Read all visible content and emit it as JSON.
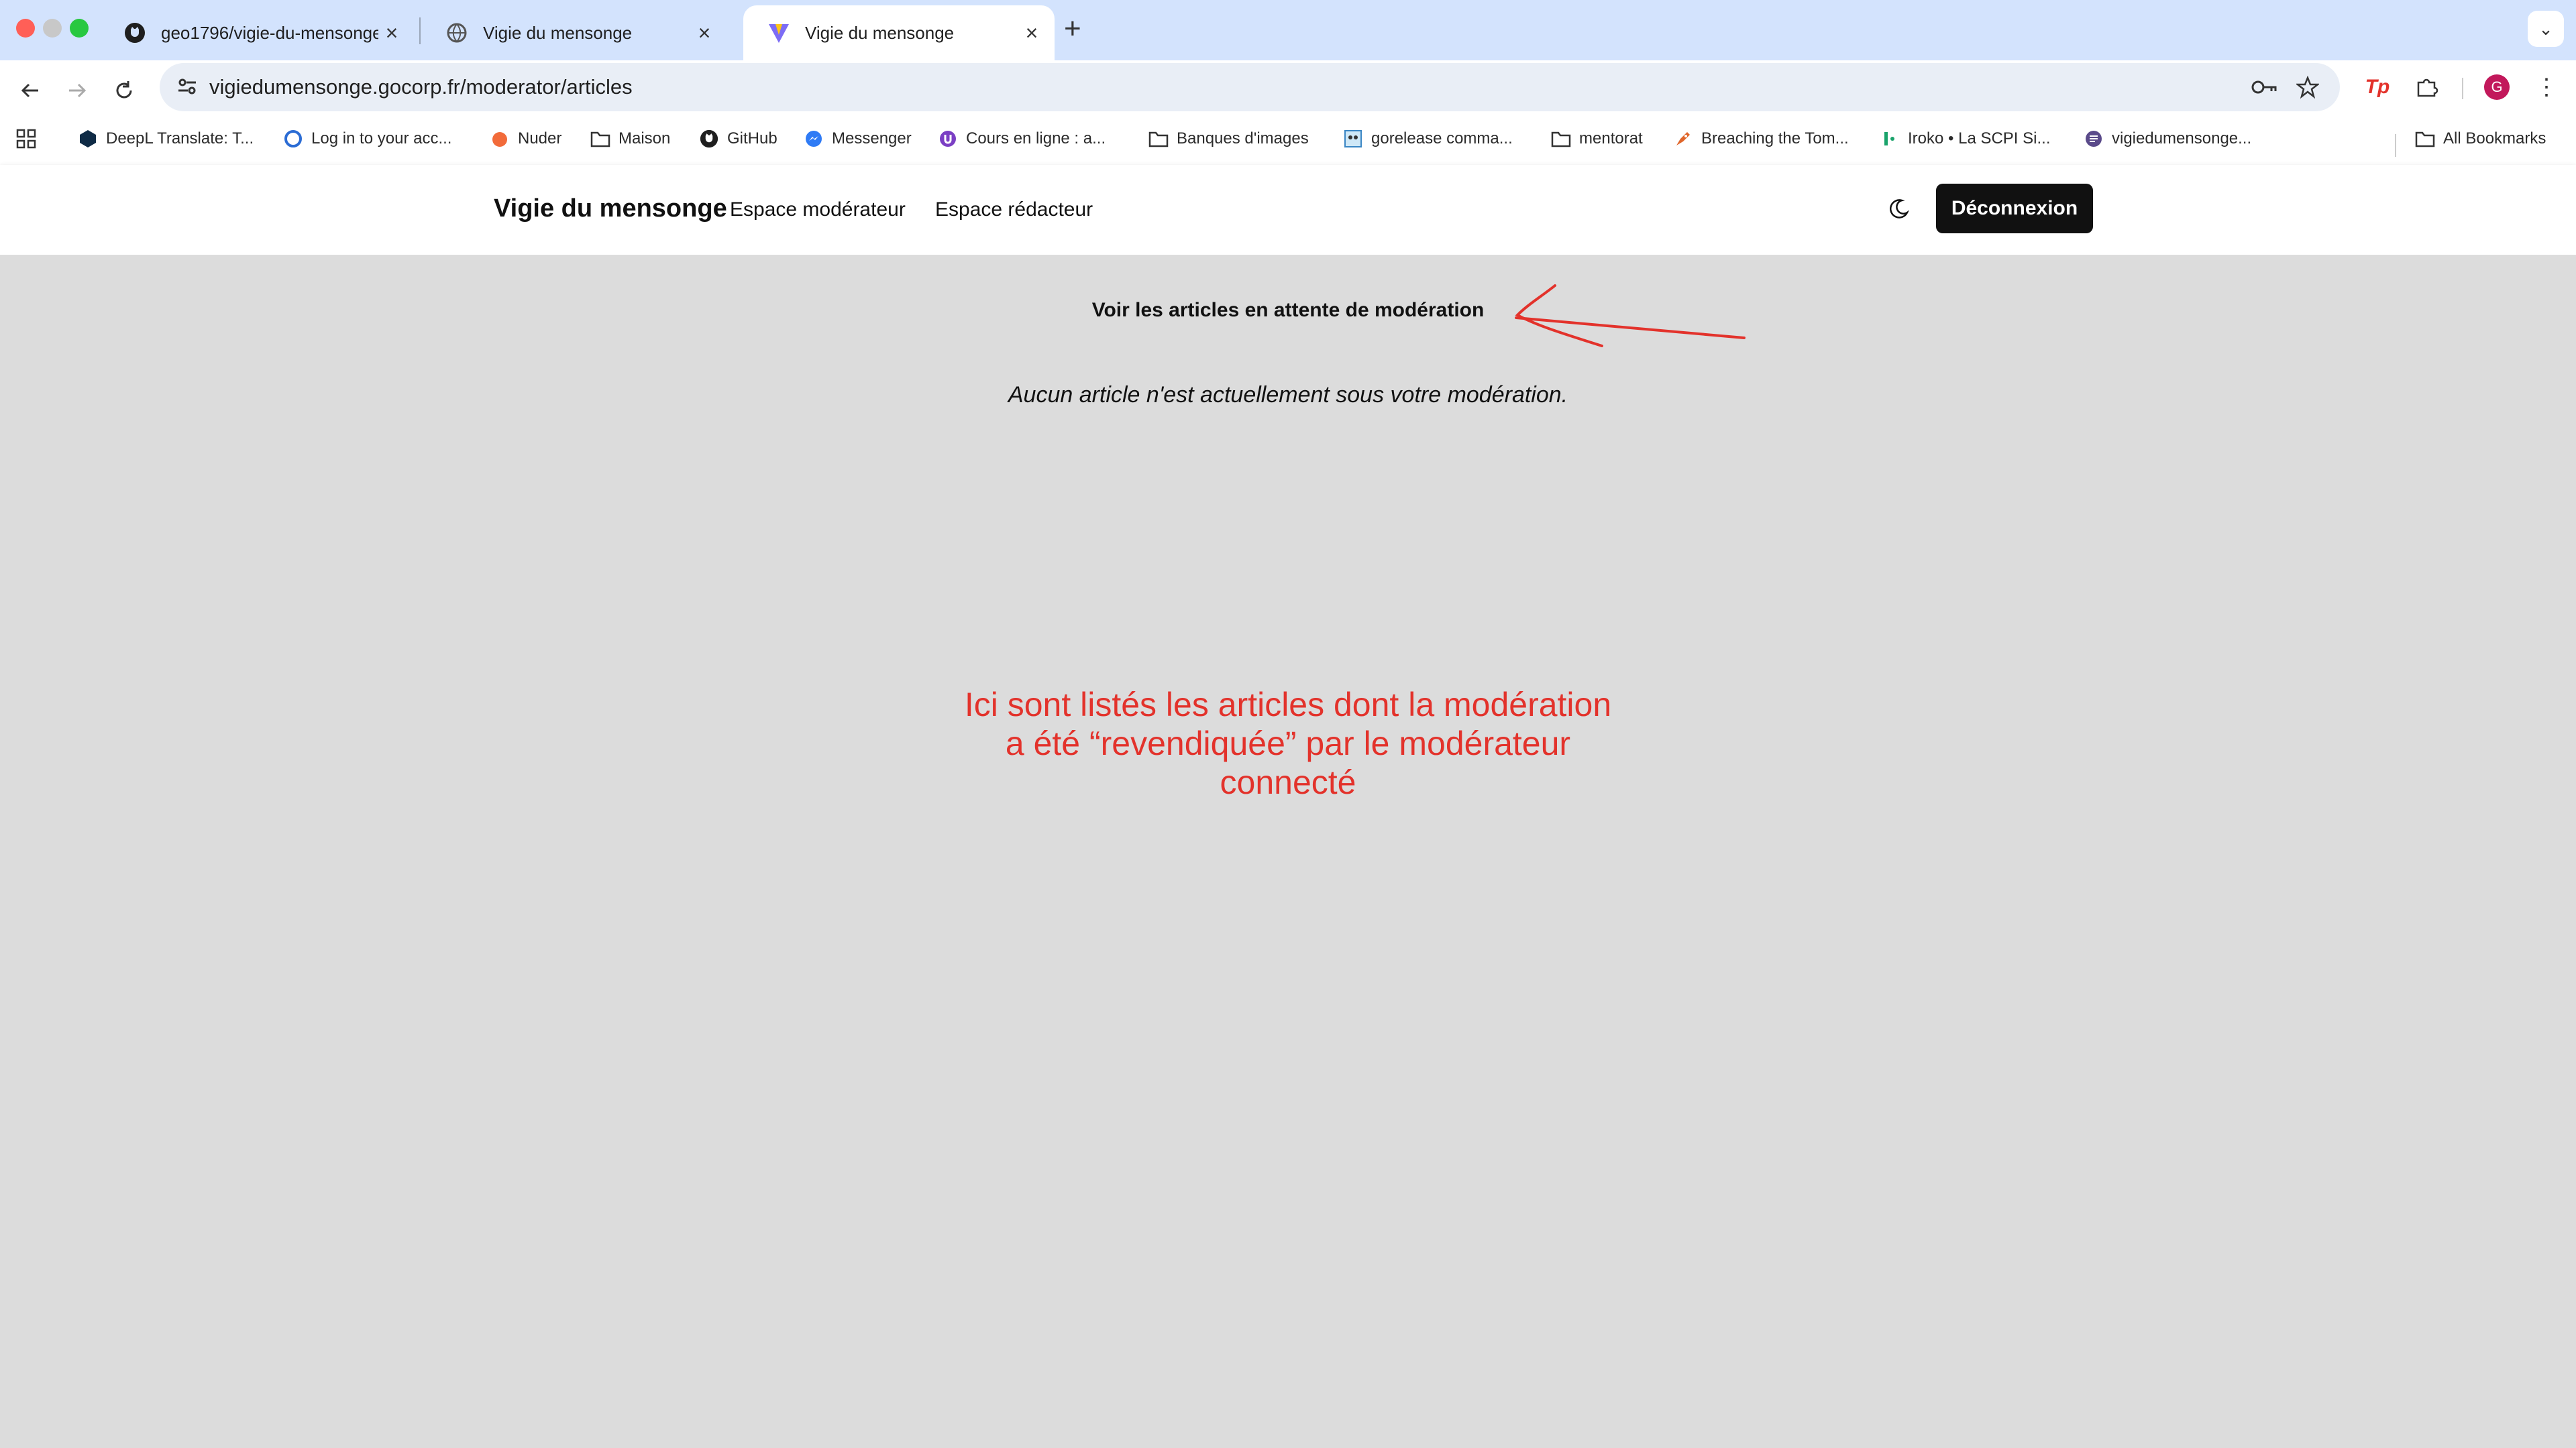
{
  "browser": {
    "tabs": [
      {
        "title": "geo1796/vigie-du-mensonge",
        "favicon": "github-icon",
        "active": false
      },
      {
        "title": "Vigie du mensonge",
        "favicon": "globe-icon",
        "active": false
      },
      {
        "title": "Vigie du mensonge",
        "favicon": "vite-icon",
        "active": true
      }
    ],
    "url": "vigiedumensonge.gocorp.fr/moderator/articles",
    "profile_initial": "G",
    "bookmarks": [
      {
        "label": "DeepL Translate: T...",
        "icon": "deepl-icon"
      },
      {
        "label": "Log in to your acc...",
        "icon": "login-icon"
      },
      {
        "label": "Nuder",
        "icon": "peach-icon"
      },
      {
        "label": "Maison",
        "icon": "folder-icon"
      },
      {
        "label": "GitHub",
        "icon": "github-icon"
      },
      {
        "label": "Messenger",
        "icon": "messenger-icon"
      },
      {
        "label": "Cours en ligne  : a...",
        "icon": "course-icon"
      },
      {
        "label": "Banques d'images",
        "icon": "folder-icon"
      },
      {
        "label": "gorelease comma...",
        "icon": "gopher-icon"
      },
      {
        "label": "mentorat",
        "icon": "folder-icon"
      },
      {
        "label": "Breaching the Tom...",
        "icon": "rocket-icon"
      },
      {
        "label": "Iroko • La SCPI Si...",
        "icon": "iroko-icon"
      },
      {
        "label": "vigiedumensonge...",
        "icon": "site-icon"
      }
    ],
    "all_bookmarks": "All Bookmarks"
  },
  "app": {
    "brand": "Vigie du mensonge",
    "nav": [
      "Espace modérateur",
      "Espace rédacteur"
    ],
    "logout": "Déconnexion"
  },
  "main": {
    "heading": "Voir les articles en attente de modération",
    "empty_message": "Aucun article n'est actuellement sous votre modération.",
    "annotation": [
      "Ici sont listés les articles dont la modération",
      "a été “revendiquée” par le modérateur",
      "connecté"
    ]
  },
  "colors": {
    "annotation": "#e3322b",
    "page_bg": "#dcdcdc",
    "tabbar_bg": "#d3e3fd",
    "logout_bg": "#111111"
  }
}
